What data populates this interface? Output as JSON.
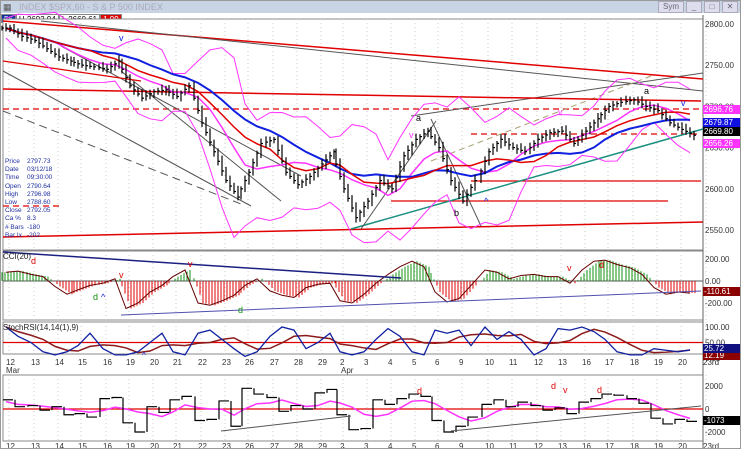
{
  "window": {
    "title": "INDEX $SPX,60 - S & P 500 INDEX",
    "sym_label": "Sym",
    "minimize": "_",
    "maximize": "□",
    "close": "✕"
  },
  "quotes": {
    "last": "56",
    "high": "H  2693.94",
    "low": "L   2660.61",
    "change": "1.99"
  },
  "info_box": [
    {
      "k": "Price",
      "v": "2797.73"
    },
    {
      "k": "Date",
      "v": "03/12/18"
    },
    {
      "k": "Time",
      "v": "09:30:00"
    },
    {
      "k": "Open",
      "v": "2790.64"
    },
    {
      "k": "High",
      "v": "2796.98"
    },
    {
      "k": "Low",
      "v": "2788.60"
    },
    {
      "k": "Close",
      "v": "2792.05"
    },
    {
      "k": "Ca %",
      "v": "8.3"
    },
    {
      "k": "# Bars",
      "v": "-180"
    },
    {
      "k": "Bar Ix",
      "v": "-202"
    }
  ],
  "price_axis": [
    "2800.00",
    "2750.00",
    "2700.00",
    "2650.00",
    "2600.00",
    "2550.00"
  ],
  "price_tags": [
    {
      "v": "2696.76",
      "color": "#ff33ff"
    },
    {
      "v": "2679.87",
      "color": "#1010e0"
    },
    {
      "v": "2669.80",
      "color": "#000000"
    },
    {
      "v": "2656.26",
      "color": "#ff33ff"
    }
  ],
  "cci": {
    "label": "CCI(20)",
    "axis": [
      "200.00",
      "0.00",
      "-200.00"
    ],
    "tag": "-110.61",
    "tag_color": "#8b0000"
  },
  "stoch": {
    "label": "StochRSI(14,14(1),9)",
    "axis": [
      "100.00",
      "50.00",
      "0.00"
    ],
    "tag": "25.72",
    "tag_color": "#101080",
    "tag2": "12.19"
  },
  "osc": {
    "axis": [
      "2000",
      "0",
      "-2000"
    ],
    "tag": "-1073",
    "tag_color": "#000000"
  },
  "dates": [
    "12",
    "13",
    "14",
    "15",
    "16",
    "19",
    "20",
    "21",
    "22",
    "23",
    "26",
    "27",
    "28",
    "29",
    "2",
    "3",
    "4",
    "5",
    "6",
    "9",
    "10",
    "11",
    "12",
    "13",
    "16",
    "17",
    "18",
    "19",
    "20",
    "23rd"
  ],
  "months": {
    "mar": "Mar",
    "apr": "Apr"
  },
  "annotations": {
    "v": "v",
    "a": "a",
    "b": "b",
    "d": "d",
    "up": "^"
  },
  "colors": {
    "up_hist": "#109010",
    "down_hist": "#e00000",
    "ma_long": "#1020e0",
    "ma_short": "#e00000",
    "bands": "#ff33ff",
    "signal": "#8b1a1a"
  },
  "chart_data": {
    "type": "ohlc",
    "interval": "60 min",
    "close_half_day": [
      2795,
      2785,
      2780,
      2770,
      2760,
      2755,
      2750,
      2748,
      2745,
      2755,
      2725,
      2710,
      2718,
      2720,
      2712,
      2725,
      2680,
      2645,
      2610,
      2590,
      2620,
      2655,
      2660,
      2620,
      2605,
      2615,
      2630,
      2645,
      2600,
      2565,
      2585,
      2610,
      2600,
      2640,
      2660,
      2670,
      2650,
      2610,
      2585,
      2610,
      2645,
      2660,
      2650,
      2645,
      2660,
      2668,
      2670,
      2655,
      2670,
      2685,
      2700,
      2705,
      2708,
      2700,
      2695,
      2680,
      2672,
      2665
    ],
    "cci": [
      80,
      90,
      60,
      40,
      -50,
      -120,
      -80,
      -40,
      -20,
      20,
      -250,
      -200,
      -100,
      -40,
      40,
      100,
      -200,
      -220,
      -180,
      -130,
      -40,
      20,
      -90,
      -130,
      -150,
      -60,
      -30,
      -20,
      -180,
      -200,
      -120,
      -20,
      60,
      130,
      180,
      130,
      -100,
      -190,
      -160,
      -40,
      100,
      80,
      20,
      50,
      60,
      40,
      40,
      -20,
      100,
      180,
      190,
      150,
      120,
      60,
      -60,
      -120,
      -100,
      -110
    ],
    "stoch": [
      100,
      70,
      50,
      20,
      10,
      20,
      40,
      80,
      30,
      10,
      10,
      20,
      50,
      80,
      20,
      10,
      80,
      90,
      60,
      30,
      5,
      20,
      70,
      100,
      90,
      30,
      50,
      80,
      20,
      10,
      20,
      60,
      95,
      70,
      20,
      10,
      90,
      80,
      90,
      40,
      100,
      60,
      85,
      60,
      10,
      30,
      95,
      90,
      100,
      85,
      60,
      20,
      10,
      10,
      30,
      25,
      20,
      26
    ],
    "osc": [
      800,
      200,
      300,
      -100,
      200,
      -500,
      -400,
      -700,
      900,
      1000,
      -1200,
      -2000,
      200,
      -300,
      800,
      1100,
      -1000,
      -900,
      700,
      -1500,
      1800,
      1300,
      1000,
      -200,
      300,
      0,
      1400,
      1700,
      -500,
      -1800,
      -1700,
      800,
      400,
      900,
      1300,
      1100,
      -1000,
      -2000,
      -1500,
      -700,
      400,
      800,
      200,
      600,
      300,
      -100,
      100,
      -400,
      600,
      900,
      1300,
      1200,
      900,
      500,
      -800,
      -1300,
      -900,
      -1073
    ]
  }
}
